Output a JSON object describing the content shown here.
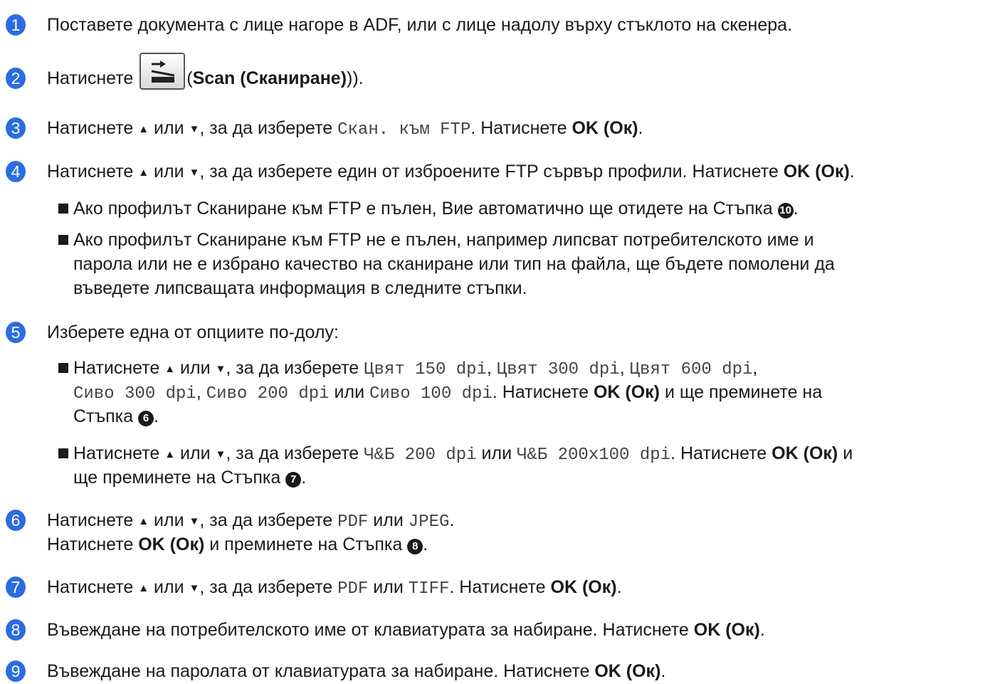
{
  "steps": [
    {
      "num": "1",
      "text": "Поставете документа с лице нагоре в ADF, или с лице надолу върху стъклото на скенера."
    },
    {
      "num": "2",
      "pre": "Натиснете",
      "paren_open": "(",
      "button_label": "Scan (Сканиране)",
      "paren_close": "))."
    },
    {
      "num": "3",
      "t1": "Натиснете",
      "up": "▲",
      "t2": "или",
      "down": "▼",
      "t3": ", за да изберете",
      "opt": "Скан. към FTP",
      "t4": ". Натиснете",
      "ok": "OK (Ок)",
      "end": "."
    },
    {
      "num": "4",
      "t1": "Натиснете",
      "up": "▲",
      "t2": "или",
      "down": "▼",
      "t3": ", за да изберете един от изброените FTP сървър профили. Натиснете",
      "ok": "OK (Ок)",
      "end": ".",
      "bullets": [
        {
          "text": "Ако профилът Сканиране към FTP е пълен, Вие автоматично ще отидете на Стъпка",
          "ref": "10",
          "end": "."
        },
        {
          "lines": [
            "Ако профилът Сканиране към FTP не е пълен, например липсват потребителското име и",
            "парола или не е избрано качество на сканиране или тип на файла, ще бъдете помолени да",
            "въведете липсващата информация в следните стъпки."
          ]
        }
      ]
    },
    {
      "num": "5",
      "text": "Изберете една от опциите по-долу:",
      "bullets": [
        {
          "t1": "Натиснете",
          "up": "▲",
          "t2": "или",
          "down": "▼",
          "t3": ", за да изберете",
          "o1": "Цвят 150 dpi",
          "o2": "Цвят 300 dpi",
          "o3": "Цвят 600 dpi",
          "o4": "Сиво 300 dpi",
          "o5": "Сиво 200 dpi",
          "or": "или",
          "o6": "Сиво 100 dpi",
          "t4": ". Натиснете",
          "ok": "OK (Ок)",
          "t5": "и ще преминете на",
          "t6": "Стъпка",
          "ref": "6",
          "end": "."
        },
        {
          "t1": "Натиснете",
          "up": "▲",
          "t2": "или",
          "down": "▼",
          "t3": ", за да изберете",
          "o1": "Ч&Б 200 dpi",
          "or": "или",
          "o2": "Ч&Б 200x100 dpi",
          "t4": ". Натиснете",
          "ok": "OK (Ок)",
          "t5": "и",
          "t6": "ще преминете на Стъпка",
          "ref": "7",
          "end": "."
        }
      ]
    },
    {
      "num": "6",
      "t1": "Натиснете",
      "up": "▲",
      "t2": "или",
      "down": "▼",
      "t3": ", за да изберете",
      "o1": "PDF",
      "or": "или",
      "o2": "JPEG",
      "end1": ".",
      "l2a": "Натиснете",
      "ok": "OK (Ок)",
      "l2b": "и преминете на Стъпка",
      "ref": "8",
      "end": "."
    },
    {
      "num": "7",
      "t1": "Натиснете",
      "up": "▲",
      "t2": "или",
      "down": "▼",
      "t3": ", за да изберете",
      "o1": "PDF",
      "or": "или",
      "o2": "TIFF",
      "t4": ". Натиснете",
      "ok": "OK (Ок)",
      "end": "."
    },
    {
      "num": "8",
      "text": "Въвеждане на потребителското име от клавиатурата за набиране. Натиснете",
      "ok": "OK (Ок)",
      "end": "."
    },
    {
      "num": "9",
      "text": "Въвеждане на паролата от клавиатурата за набиране. Натиснете",
      "ok": "OK (Ок)",
      "end": "."
    }
  ],
  "colors": {
    "badge": "#2b6de0",
    "text": "#1a1a1a",
    "mono": "#444444"
  },
  "icons": {
    "scan_button": "scan-icon",
    "step_ref": "numbered-circle-icon"
  }
}
